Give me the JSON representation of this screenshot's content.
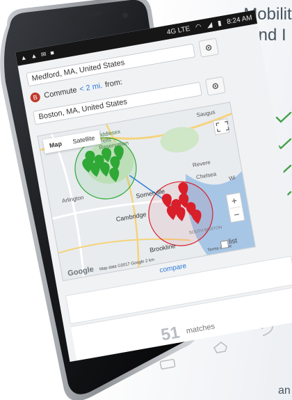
{
  "headline": {
    "line1": "Mobilit",
    "line2": "and I"
  },
  "status": {
    "network": "4G LTE",
    "time": "8:24 AM"
  },
  "origin": {
    "value": "Medford, MA, United States"
  },
  "commute": {
    "badge": "B",
    "label": "Commute",
    "distance": "< 2 mi.",
    "from": "from:",
    "value": "Boston, MA, United States"
  },
  "map": {
    "tabs": [
      "Map",
      "Satellite"
    ],
    "labels": {
      "saugus": "Saugus",
      "middlesex": "Middlesex\nFells\nReservation",
      "arlington": "Arlington",
      "revere": "Revere",
      "chelsea": "Chelsea",
      "somerville": "Somerville",
      "cambridge": "Cambridge",
      "south_boston": "SOUTH BOSTON",
      "brookline": "Brookline",
      "winthrop": "Wi"
    },
    "footer": "Map data ©2017 Google  2 km",
    "terms": "Terms of Use",
    "logo": "Google",
    "zoom_in": "+",
    "zoom_out": "−"
  },
  "list_label": "list",
  "compare_label": "compare",
  "matches": {
    "count": "51",
    "label": "matches"
  },
  "colors": {
    "green": "#2fa836",
    "red": "#d81f2a",
    "link": "#2f7bd8",
    "headline": "#475560",
    "check": "#43a047"
  },
  "checks_count": 4,
  "corner_text": "an"
}
